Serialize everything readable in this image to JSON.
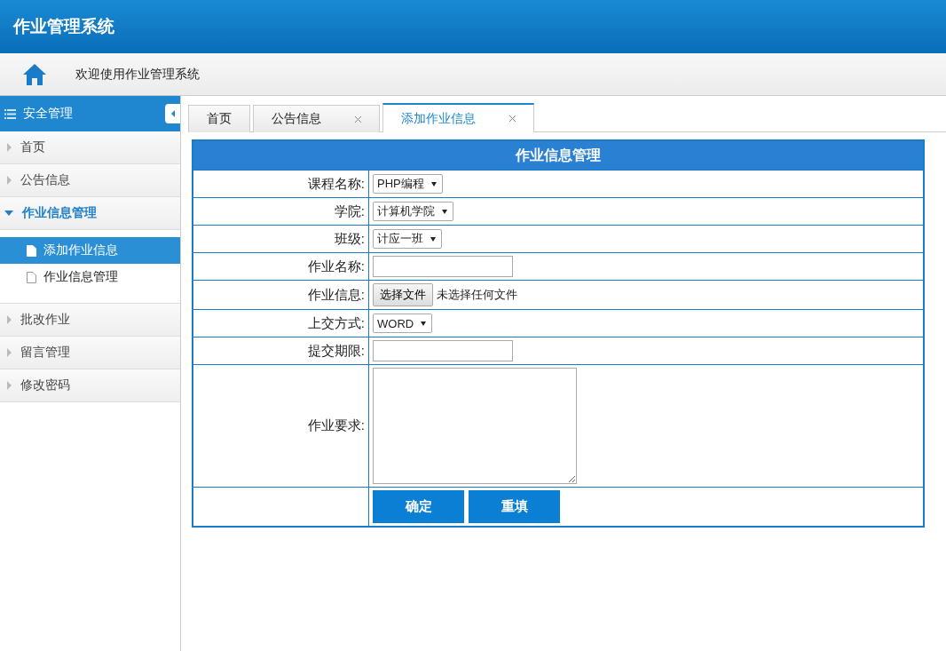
{
  "header": {
    "title": "作业管理系统"
  },
  "welcome": "欢迎使用作业管理系统",
  "sidebar": {
    "title": "安全管理",
    "items": [
      {
        "label": "首页",
        "expanded": false
      },
      {
        "label": "公告信息",
        "expanded": false
      },
      {
        "label": "作业信息管理",
        "expanded": true,
        "children": [
          {
            "label": "添加作业信息",
            "selected": true
          },
          {
            "label": "作业信息管理",
            "selected": false
          }
        ]
      },
      {
        "label": "批改作业",
        "expanded": false
      },
      {
        "label": "留言管理",
        "expanded": false
      },
      {
        "label": "修改密码",
        "expanded": false
      }
    ]
  },
  "tabs": [
    {
      "label": "首页",
      "selected": false,
      "closable": false
    },
    {
      "label": "公告信息",
      "selected": false,
      "closable": true
    },
    {
      "label": "添加作业信息",
      "selected": true,
      "closable": true
    }
  ],
  "form": {
    "title": "作业信息管理",
    "rows": [
      {
        "label": "课程名称:",
        "kind": "select",
        "value": "PHP编程"
      },
      {
        "label": "学院:",
        "kind": "select",
        "value": "计算机学院"
      },
      {
        "label": "班级:",
        "kind": "select",
        "value": "计应一班"
      },
      {
        "label": "作业名称:",
        "kind": "text"
      },
      {
        "label": "作业信息:",
        "kind": "file",
        "button": "选择文件",
        "status": "未选择任何文件"
      },
      {
        "label": "上交方式:",
        "kind": "select",
        "value": "WORD"
      },
      {
        "label": "提交期限:",
        "kind": "text"
      },
      {
        "label": "作业要求:",
        "kind": "textarea"
      }
    ],
    "buttons": [
      "确定",
      "重填"
    ]
  }
}
